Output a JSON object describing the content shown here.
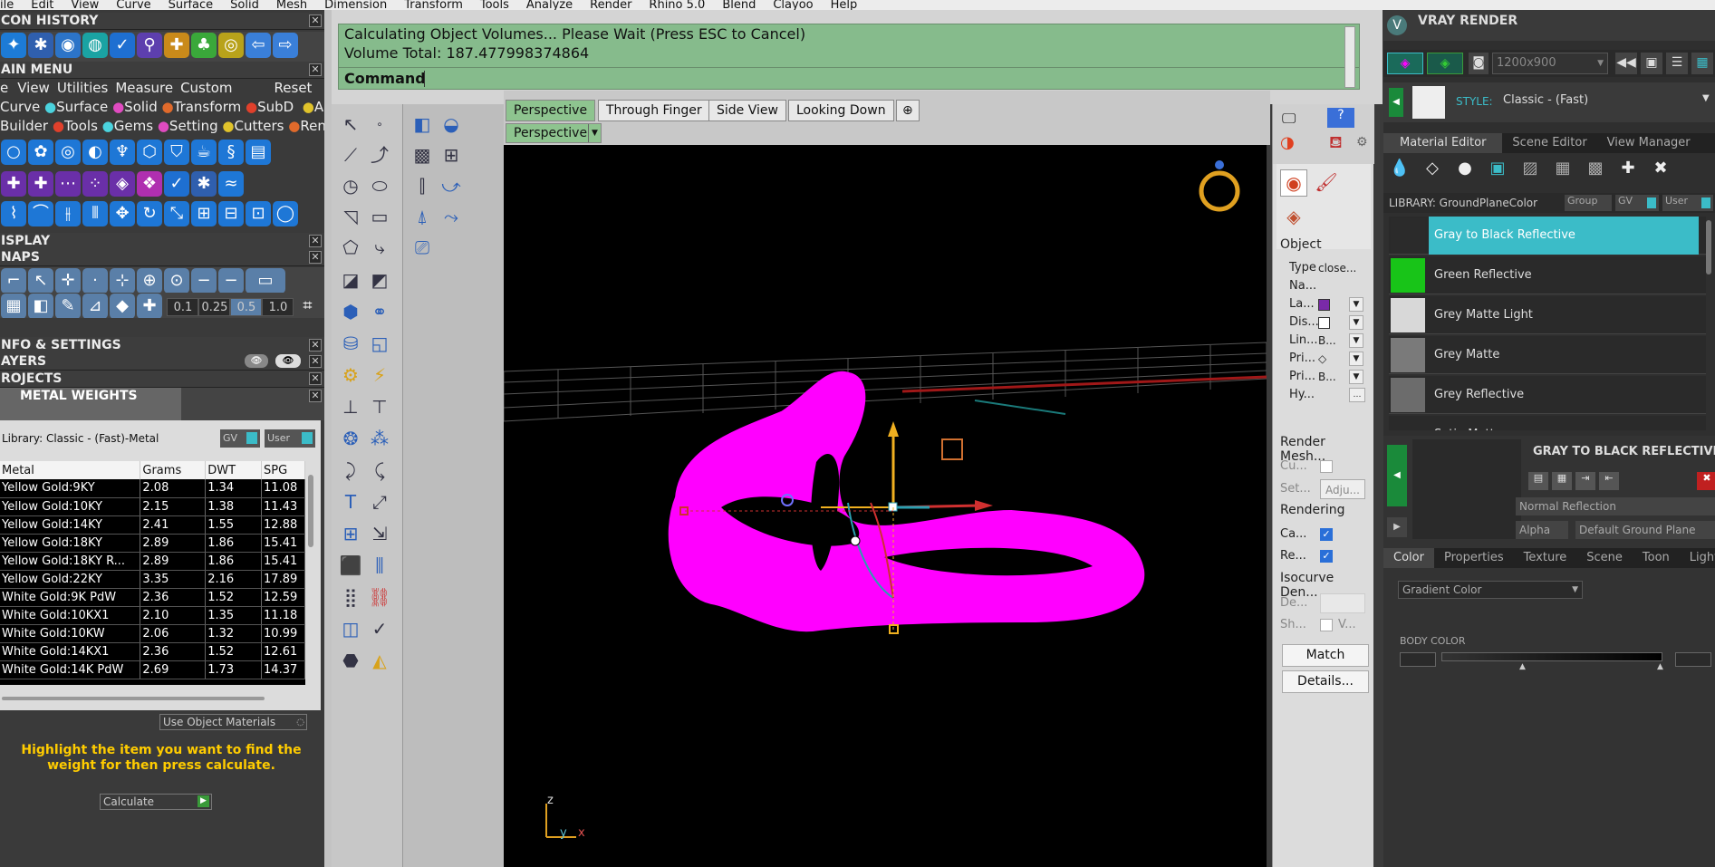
{
  "menubar": [
    "ile",
    "Edit",
    "View",
    "Curve",
    "Surface",
    "Solid",
    "Mesh",
    "Dimension",
    "Transform",
    "Tools",
    "Analyze",
    "Render",
    "Rhino 5.0",
    "Blend",
    "Clayoo",
    "Help"
  ],
  "left": {
    "icon_history_title": "CON HISTORY",
    "main_menu_title": "AIN MENU",
    "main_menu_items": [
      "e",
      "View",
      "Utilities",
      "Measure",
      "Custom",
      "Reset"
    ],
    "main_menu_row2": [
      "Curve",
      "Surface",
      "Solid",
      "Transform",
      "SubD",
      "Art"
    ],
    "main_menu_row3": [
      "Builder",
      "Tools",
      "Gems",
      "Setting",
      "Cutters",
      "Render"
    ],
    "display_title": "ISPLAY",
    "snaps_title": "NAPS",
    "snap_values": [
      "0.1",
      "0.25",
      "0.5",
      "1.0"
    ],
    "info_title": "NFO & SETTINGS",
    "layers_title": "AYERS",
    "projects_title": "ROJECTS",
    "metal_weights_title": "METAL WEIGHTS",
    "library_label": "Library: Classic - (Fast)-Metal",
    "gv_label": "GV",
    "user_label": "User",
    "table_headers": [
      "Metal",
      "Grams",
      "DWT",
      "SPG"
    ],
    "table_rows": [
      [
        "Yellow Gold:9KY",
        "2.08",
        "1.34",
        "11.08"
      ],
      [
        "Yellow Gold:10KY",
        "2.15",
        "1.38",
        "11.43"
      ],
      [
        "Yellow Gold:14KY",
        "2.41",
        "1.55",
        "12.88"
      ],
      [
        "Yellow Gold:18KY",
        "2.89",
        "1.86",
        "15.41"
      ],
      [
        "Yellow Gold:18KY R...",
        "2.89",
        "1.86",
        "15.41"
      ],
      [
        "Yellow Gold:22KY",
        "3.35",
        "2.16",
        "17.89"
      ],
      [
        "White Gold:9K PdW",
        "2.36",
        "1.52",
        "12.59"
      ],
      [
        "White Gold:10KX1",
        "2.10",
        "1.35",
        "11.18"
      ],
      [
        "White Gold:10KW",
        "2.06",
        "1.32",
        "10.99"
      ],
      [
        "White Gold:14KX1",
        "2.36",
        "1.52",
        "12.61"
      ],
      [
        "White Gold:14K PdW",
        "2.69",
        "1.73",
        "14.37"
      ]
    ],
    "use_object_materials": "Use Object Materials",
    "hint": "Highlight the item you want to find the weight for then press calculate.",
    "calculate": "Calculate"
  },
  "command": {
    "line1": "Calculating Object Volumes... Please Wait (Press ESC to Cancel)",
    "line2": "Volume Total: 187.477998374864",
    "prompt": "Command:"
  },
  "viewport": {
    "tabs": [
      "Perspective",
      "Through Finger",
      "Side View",
      "Looking Down"
    ],
    "active_label": "Perspective",
    "axis_z": "z",
    "axis_y": "y",
    "axis_x": "x"
  },
  "props": {
    "object_title": "Object",
    "rows": [
      {
        "label": "Type",
        "value": "close..."
      },
      {
        "label": "Na...",
        "value": ""
      },
      {
        "label": "La...",
        "value": ""
      },
      {
        "label": "Dis...",
        "value": ""
      },
      {
        "label": "Lin...",
        "value": "B..."
      },
      {
        "label": "Pri...",
        "value": "◇"
      },
      {
        "label": "Pri...",
        "value": "B..."
      },
      {
        "label": "Hy...",
        "value": ""
      }
    ],
    "render_mesh_title": "Render Mesh...",
    "render_mesh_rows": [
      "Cu...",
      "Set..."
    ],
    "adju": "Adju...",
    "rendering_title": "Rendering",
    "rendering_rows": [
      "Ca...",
      "Re..."
    ],
    "isocurve_title": "Isocurve Den...",
    "iso_rows": [
      "De...",
      "Sh..."
    ],
    "iso_v": "V...",
    "match": "Match",
    "details": "Details..."
  },
  "vray": {
    "title": "VRAY RENDER",
    "resolution": "1200x900",
    "style_label": "STYLE:",
    "style_value": "Classic - (Fast)",
    "tabs": [
      "Material Editor",
      "Scene Editor",
      "View Manager"
    ],
    "library_label": "LIBRARY: GroundPlaneColor",
    "group_label": "Group",
    "gv_label": "GV",
    "user_label": "User",
    "materials": [
      {
        "name": "Gray to Black Reflective",
        "color": "#2b2b2b",
        "selected": true
      },
      {
        "name": "Green Reflective",
        "color": "#18c418",
        "selected": false
      },
      {
        "name": "Grey Matte Light",
        "color": "#d8d8d8",
        "selected": false
      },
      {
        "name": "Grey Matte",
        "color": "#7a7a7a",
        "selected": false
      },
      {
        "name": "Grey Reflective",
        "color": "#6c6c6c",
        "selected": false
      }
    ],
    "partial_next": "Satin Matte",
    "selected_title": "GRAY TO BLACK REFLECTIVE",
    "reflection_mode": "Normal Reflection",
    "alpha_label": "Alpha",
    "ground_plane": "Default Ground Plane",
    "bottom_tabs": [
      "Color",
      "Properties",
      "Texture",
      "Scene",
      "Toon",
      "Lights"
    ],
    "gradient": "Gradient Color",
    "body_color": "BODY COLOR"
  },
  "colors": {
    "accent": "#3bbcc8",
    "command_bg": "#86bb8c",
    "ring": "#ff00ff",
    "selected_row": "#3bbcc8"
  }
}
